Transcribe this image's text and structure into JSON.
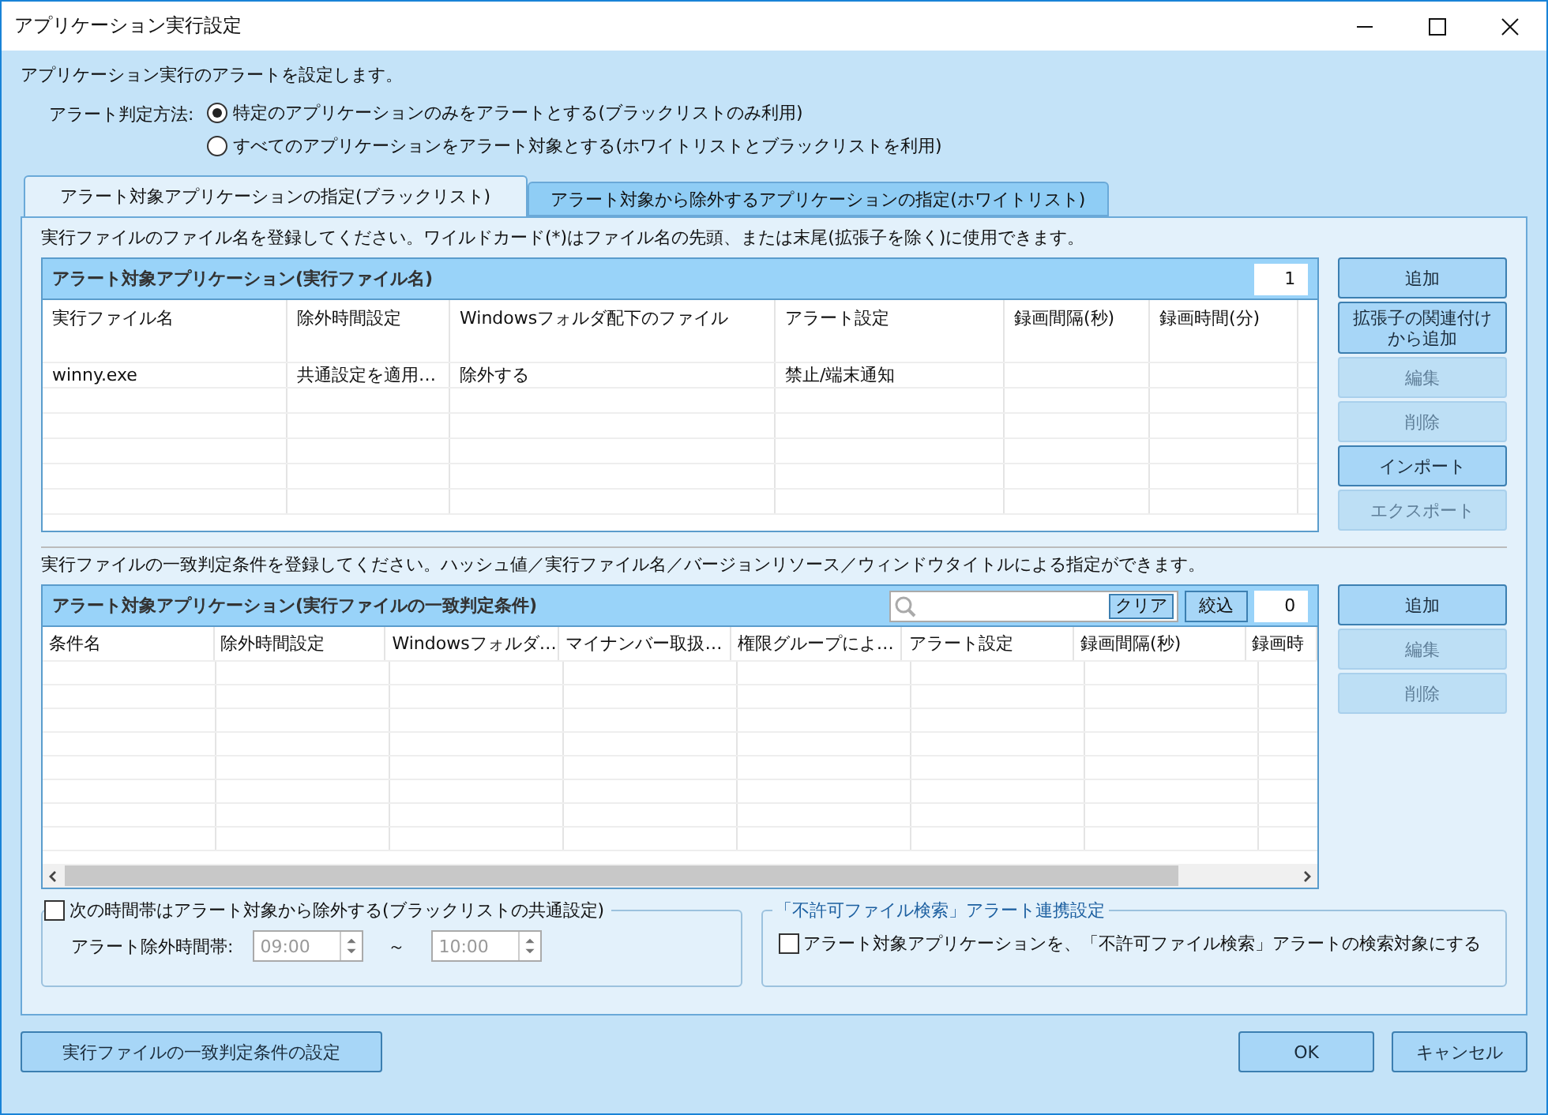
{
  "window": {
    "title": "アプリケーション実行設定"
  },
  "description": "アプリケーション実行のアラートを設定します。",
  "alert_method": {
    "label": "アラート判定方法:",
    "options": [
      {
        "label": "特定のアプリケーションのみをアラートとする(ブラックリストのみ利用)",
        "selected": true
      },
      {
        "label": "すべてのアプリケーションをアラート対象とする(ホワイトリストとブラックリストを利用)",
        "selected": false
      }
    ]
  },
  "tabs": [
    {
      "label": "アラート対象アプリケーションの指定(ブラックリスト)",
      "selected": true
    },
    {
      "label": "アラート対象から除外するアプリケーションの指定(ホワイトリスト)",
      "selected": false
    }
  ],
  "blacklist": {
    "instruction": "実行ファイルのファイル名を登録してください。ワイルドカード(*)はファイル名の先頭、または末尾(拡張子を除く)に使用できます。",
    "table": {
      "title": "アラート対象アプリケーション(実行ファイル名)",
      "count": "1",
      "columns": [
        "実行ファイル名",
        "除外時間設定",
        "Windowsフォルダ配下のファイル",
        "アラート設定",
        "録画間隔(秒)",
        "録画時間(分)"
      ],
      "rows": [
        [
          "winny.exe",
          "共通設定を適用…",
          "除外する",
          "禁止/端末通知",
          "",
          ""
        ]
      ]
    },
    "buttons": [
      {
        "label": "追加",
        "disabled": false
      },
      {
        "label": "拡張子の関連付けから追加",
        "disabled": false
      },
      {
        "label": "編集",
        "disabled": true
      },
      {
        "label": "削除",
        "disabled": true
      },
      {
        "label": "インポート",
        "disabled": false
      },
      {
        "label": "エクスポート",
        "disabled": true
      }
    ]
  },
  "conditions": {
    "instruction": "実行ファイルの一致判定条件を登録してください。ハッシュ値／実行ファイル名／バージョンリソース／ウィンドウタイトルによる指定ができます。",
    "table": {
      "title": "アラート対象アプリケーション(実行ファイルの一致判定条件)",
      "clear_button": "クリア",
      "filter_button": "絞込",
      "count": "0",
      "columns": [
        "条件名",
        "除外時間設定",
        "Windowsフォルダ…",
        "マイナンバー取扱…",
        "権限グループによ…",
        "アラート設定",
        "録画間隔(秒)",
        "録画時"
      ]
    },
    "buttons": [
      {
        "label": "追加",
        "disabled": false
      },
      {
        "label": "編集",
        "disabled": true
      },
      {
        "label": "削除",
        "disabled": true
      }
    ]
  },
  "time_exclusion": {
    "label": "次の時間帯はアラート対象から除外する(ブラックリストの共通設定)",
    "checked": false,
    "range_label": "アラート除外時間帯:",
    "from": "09:00",
    "separator": "～",
    "to": "10:00",
    "disabled": true
  },
  "linkage": {
    "title": "「不許可ファイル検索」アラート連携設定",
    "label": "アラート対象アプリケーションを、「不許可ファイル検索」アラートの検索対象にする",
    "checked": false
  },
  "footer": {
    "conditions_button": "実行ファイルの一致判定条件の設定",
    "ok_button": "OK",
    "cancel_button": "キャンセル"
  }
}
